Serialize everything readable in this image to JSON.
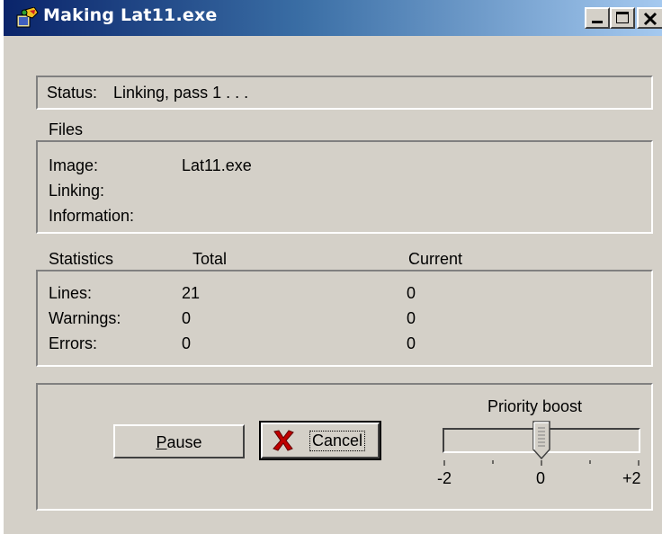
{
  "window": {
    "title": "Making Lat11.exe",
    "controls": {
      "minimize": "minimize",
      "maximize": "maximize",
      "close": "close"
    }
  },
  "status": {
    "label": "Status:",
    "text": "Linking, pass 1 . . ."
  },
  "files": {
    "heading": "Files",
    "image_label": "Image:",
    "image_value": "Lat11.exe",
    "linking_label": "Linking:",
    "linking_value": "",
    "information_label": "Information:",
    "information_value": ""
  },
  "statistics": {
    "heading": "Statistics",
    "col_total": "Total",
    "col_current": "Current",
    "rows": [
      {
        "label": "Lines:",
        "total": "21",
        "current": "0"
      },
      {
        "label": "Warnings:",
        "total": "0",
        "current": "0"
      },
      {
        "label": "Errors:",
        "total": "0",
        "current": "0"
      }
    ]
  },
  "controls": {
    "pause_label_first": "P",
    "pause_label_rest": "ause",
    "cancel_label": "Cancel",
    "priority_label": "Priority boost",
    "slider_min_label": "-2",
    "slider_mid_label": "0",
    "slider_max_label": "+2",
    "slider_value": 0,
    "slider_range": [
      -2,
      2
    ]
  }
}
